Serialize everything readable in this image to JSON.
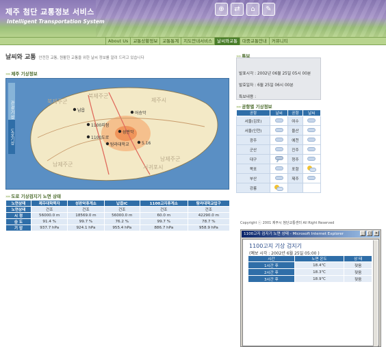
{
  "header": {
    "title": "제주 첨단 교통정보 서비스",
    "subtitle": "Intelligent Transportation System",
    "icons": [
      "map-icon",
      "traffic-icon",
      "car-icon",
      "notice-icon"
    ]
  },
  "nav": {
    "items": [
      {
        "label": "About Us",
        "active": false
      },
      {
        "label": "교통상황정보",
        "active": false
      },
      {
        "label": "교통통계",
        "active": false
      },
      {
        "label": "지도안내서비스",
        "active": false
      },
      {
        "label": "날씨와교통",
        "active": true
      },
      {
        "label": "대중교통안내",
        "active": false
      },
      {
        "label": "커뮤니티",
        "active": false
      }
    ]
  },
  "page": {
    "title": "날씨와 교통",
    "description": "안전한 교통, 원활한 교통을 위한 날씨 정보를 알려 드리고 있습니다",
    "weather_section": "제주 기상정보",
    "road_section": "도로 기상검지기 노면 상태"
  },
  "map": {
    "tabs": [
      "관광기상",
      "도로기상"
    ],
    "labels": [
      "북제주군",
      "북제주군",
      "남제주군",
      "남제주군",
      "제주시",
      "서귀포시"
    ],
    "stations": [
      "납읍",
      "어승악",
      "1100지점",
      "성판악",
      "탐라대학교",
      "5.16",
      "1100도로"
    ]
  },
  "road_table": {
    "headers": [
      "노면상태",
      "제주대학목자",
      "성판악휴게소",
      "납읍IC",
      "1100고지휴게소",
      "탐라대학교입구"
    ],
    "rows": [
      {
        "label": "노면상태",
        "values": [
          "건조",
          "건조",
          "건조",
          "건조",
          "건조"
        ]
      },
      {
        "label": "시 정",
        "values": [
          "56000.0 m",
          "18569.0 m",
          "56000.0 m",
          "60.0 m",
          "42290.0 m"
        ]
      },
      {
        "label": "습 도",
        "values": [
          "91.4 %",
          "99.7 %",
          "76.2 %",
          "99.7 %",
          "78.7 %"
        ]
      },
      {
        "label": "기 압",
        "values": [
          "937.7 hPa",
          "924.1 hPa",
          "955.4 hPa",
          "886.7 hPa",
          "958.9 hPa"
        ]
      }
    ]
  },
  "forecast": {
    "section": "특보",
    "lines": [
      "발표시각 : 2002년 06월 25일 05시 00분",
      "발효일자 : 6월 25일 06시 00분",
      "특보내용 :"
    ]
  },
  "airport": {
    "section": "공항별 기상정보",
    "headers": [
      "공항",
      "날씨",
      "공항",
      "날씨"
    ],
    "rows": [
      [
        "서울(김포)",
        "cloud-icon",
        "여수",
        "cloud-icon"
      ],
      [
        "서울(인천)",
        "cloud-icon",
        "울산",
        "cloud-icon"
      ],
      [
        "광주",
        "cloud-icon",
        "예천",
        "cloud-icon"
      ],
      [
        "군산",
        "cloud-icon",
        "진주",
        "cloud-icon"
      ],
      [
        "대구",
        "rain-cloud-icon",
        "청주",
        "cloud-icon"
      ],
      [
        "목포",
        "cloud-icon",
        "포항",
        "sun-cloud-icon"
      ],
      [
        "부산",
        "cloud-icon",
        "제주",
        "cloud-icon"
      ],
      [
        "강릉",
        "sun-cloud-icon",
        "",
        ""
      ]
    ]
  },
  "copyright": "Copyright ⓒ 2001 제주시 첨단교통센터 All Right Reserved",
  "popup": {
    "titlebar": "1100고지 검지기 노면 상태 - Microsoft Internet Explorer",
    "title": "1100고지 기상 검지기",
    "subtitle": "(예보 시각 : 2002년 6월 25일 05:00 )",
    "headers": [
      "시간",
      "노면 온도",
      "상 태"
    ],
    "rows": [
      [
        "1시간 후",
        "18.4℃",
        "젖음"
      ],
      [
        "2시간 후",
        "18.3℃",
        "젖음"
      ],
      [
        "3시간 후",
        "18.9℃",
        "젖음"
      ]
    ]
  }
}
